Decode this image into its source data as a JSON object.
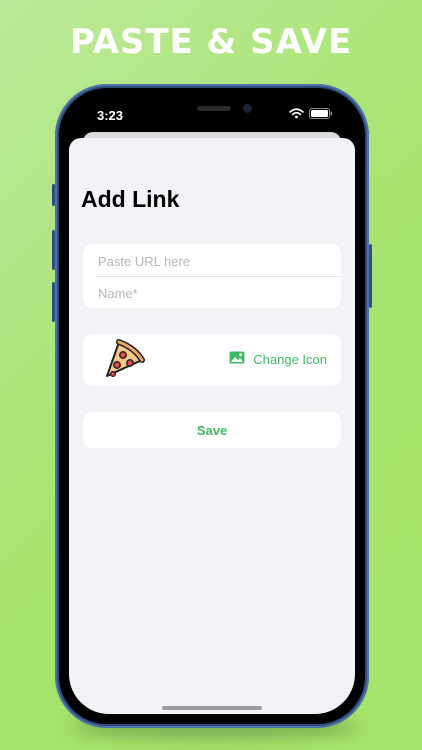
{
  "headline": "PASTE & SAVE",
  "status_bar": {
    "time": "3:23"
  },
  "sheet": {
    "title": "Add Link",
    "url_field": {
      "value": "",
      "placeholder": "Paste URL here"
    },
    "name_field": {
      "value": "",
      "placeholder": "Name*"
    },
    "icon_preview": "pizza-slice-icon",
    "change_icon_label": "Change Icon",
    "save_label": "Save"
  },
  "colors": {
    "accent": "#3dbb63",
    "background_green": "#a6e56b",
    "phone_frame": "#2c4a7a",
    "sheet_bg": "#f2f2f7"
  }
}
